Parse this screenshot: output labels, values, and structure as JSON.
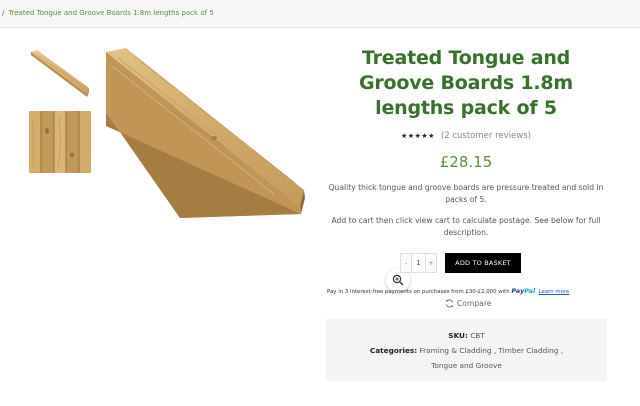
{
  "breadcrumb": {
    "separator": "/",
    "current": "Treated Tongue and Groove Boards 1.8m lengths pack of 5"
  },
  "product": {
    "title": "Treated Tongue and Groove Boards 1.8m lengths pack of 5",
    "rating_stars": "★★★★★",
    "rating_value": 5,
    "reviews_link": "(2 customer reviews)",
    "price": "£28.15",
    "description_1": "Quality thick tongue and groove boards are pressure treated and sold in packs of 5.",
    "description_2": "Add to cart then click view cart to calculate postage. See below for full description."
  },
  "cart": {
    "qty_minus": "-",
    "quantity": "1",
    "qty_plus": "+",
    "add_button": "ADD TO BASKET"
  },
  "paypal": {
    "message": "Pay in 3 interest-free payments on purchases from £30-£2,000 with",
    "brand_pay": "Pay",
    "brand_pal": "Pal",
    "learn_more": "Learn more"
  },
  "compare": {
    "label": "Compare"
  },
  "meta": {
    "sku_label": "SKU:",
    "sku_value": "CBT",
    "categories_label": "Categories:",
    "category_1": "Framing & Cladding",
    "category_2": "Timber Cladding",
    "category_3": "Tongue and Groove",
    "separator": ","
  },
  "colors": {
    "brand_green": "#3a6f2e",
    "accent_green": "#5b8e3e",
    "button_black": "#000000",
    "meta_bg": "#f4f4f4"
  },
  "icons": {
    "zoom": "magnifier-plus-icon",
    "compare": "refresh-arrows-icon"
  }
}
